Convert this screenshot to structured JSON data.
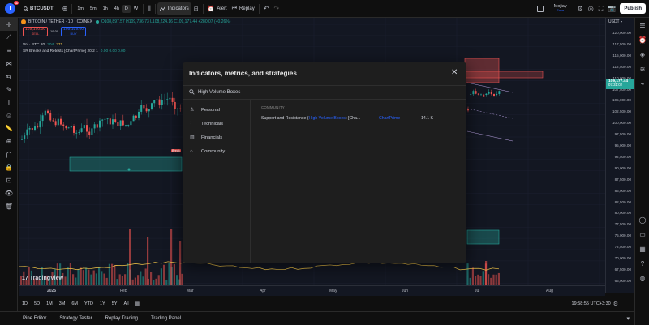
{
  "topbar": {
    "symbol": "BTCUSDT",
    "notif_count": "11",
    "intervals": [
      "1m",
      "5m",
      "1h",
      "4h",
      "D",
      "W"
    ],
    "active_interval": "D",
    "indicators_label": "Indicators",
    "alert_label": "Alert",
    "replay_label": "Replay",
    "user_name": "Mojiay",
    "user_sub": "Save",
    "publish_label": "Publish"
  },
  "legend": {
    "pair": "BITCOIN / TETHER · 1D · COINEX",
    "ohlc": "O108,897.57 H109,736.73 L108,224.16 C109,177.44 +280.07 (+0.26%)",
    "sell_price": "109,170.00",
    "sell_label": "SELL",
    "spread": "19.00",
    "buy_price": "109,189.00",
    "buy_label": "BUY",
    "vol_label": "Vol · BTC 20",
    "vol_v1": "304",
    "vol_v2": "371",
    "indicator_name": "SR Breaks and Retests [ChartPrime] 20 2 1",
    "indicator_values": "0.00 0.00 0.00"
  },
  "price_axis": {
    "currency": "USDT",
    "labels": [
      "120,000.00",
      "117,500.00",
      "115,000.00",
      "112,500.00",
      "110,000.00",
      "107,500.00",
      "105,000.00",
      "102,500.00",
      "100,000.00",
      "97,500.00",
      "95,000.00",
      "92,500.00",
      "90,000.00",
      "87,500.00",
      "85,000.00",
      "82,500.00",
      "80,000.00",
      "77,500.00",
      "75,000.00",
      "72,500.00",
      "70,000.00",
      "67,500.00",
      "65,000.00"
    ],
    "current_price": "109,177.44",
    "countdown": "07:31:02"
  },
  "time_axis": {
    "labels": [
      "2025",
      "Feb",
      "Mar",
      "Apr",
      "May",
      "Jun",
      "Jul",
      "Aug"
    ]
  },
  "chart_marks": {
    "break_label": "Break",
    "watermark": "TradingView"
  },
  "timeframes": {
    "items": [
      "1D",
      "5D",
      "1M",
      "3M",
      "6M",
      "YTD",
      "1Y",
      "5Y",
      "All"
    ],
    "clock": "19:58:55 UTC+3:30"
  },
  "bottom_tabs": [
    "Pine Editor",
    "Strategy Tester",
    "Replay Trading",
    "Trading Panel"
  ],
  "modal": {
    "title": "Indicators, metrics, and strategies",
    "search_value": "High Volume Boxes",
    "categories": [
      "Personal",
      "Technicals",
      "Financials",
      "Community"
    ],
    "section_label": "COMMUNITY",
    "result": {
      "name_prefix": "Support and Resistance (",
      "name_highlight": "High Volume Boxes",
      "name_suffix": ") [Cha...",
      "author": "ChartPrime",
      "likes": "14.1 K"
    }
  },
  "colors": {
    "up": "#26a69a",
    "down": "#ef5350",
    "accent": "#2962ff",
    "bg": "#131722"
  }
}
